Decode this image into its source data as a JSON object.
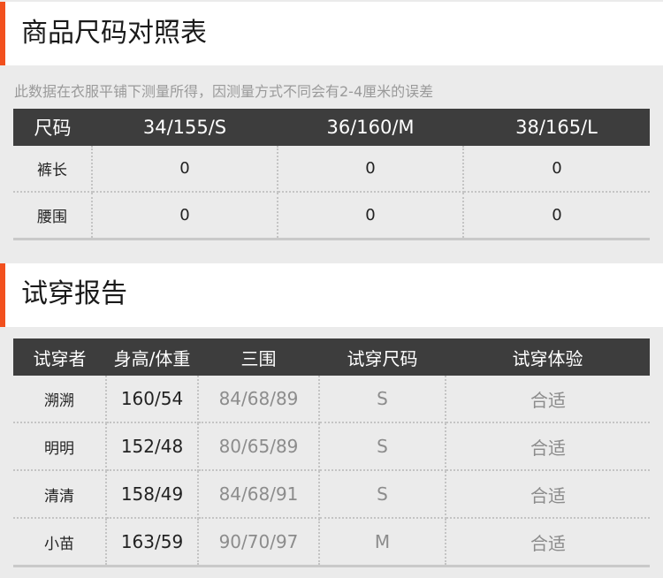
{
  "size_section": {
    "title": "商品尺码对照表",
    "note": "此数据在衣服平铺下测量所得，因测量方式不同会有2-4厘米的误差",
    "headers": [
      "尺码",
      "34/155/S",
      "36/160/M",
      "38/165/L"
    ],
    "rows": [
      {
        "label": "裤长",
        "values": [
          "0",
          "0",
          "0"
        ]
      },
      {
        "label": "腰围",
        "values": [
          "0",
          "0",
          "0"
        ]
      }
    ]
  },
  "trial_section": {
    "title": "试穿报告",
    "headers": [
      "试穿者",
      "身高/体重",
      "三围",
      "试穿尺码",
      "试穿体验"
    ],
    "rows": [
      {
        "name": "溯溯",
        "height_weight": "160/54",
        "measurements": "84/68/89",
        "size": "S",
        "experience": "合适"
      },
      {
        "name": "明明",
        "height_weight": "152/48",
        "measurements": "80/65/89",
        "size": "S",
        "experience": "合适"
      },
      {
        "name": "清清",
        "height_weight": "158/49",
        "measurements": "84/68/91",
        "size": "S",
        "experience": "合适"
      },
      {
        "name": "小苗",
        "height_weight": "163/59",
        "measurements": "90/70/97",
        "size": "M",
        "experience": "合适"
      }
    ]
  },
  "colors": {
    "accent": "#f2501e",
    "header_bg": "#3d3d3d",
    "page_bg": "#ebebeb"
  }
}
